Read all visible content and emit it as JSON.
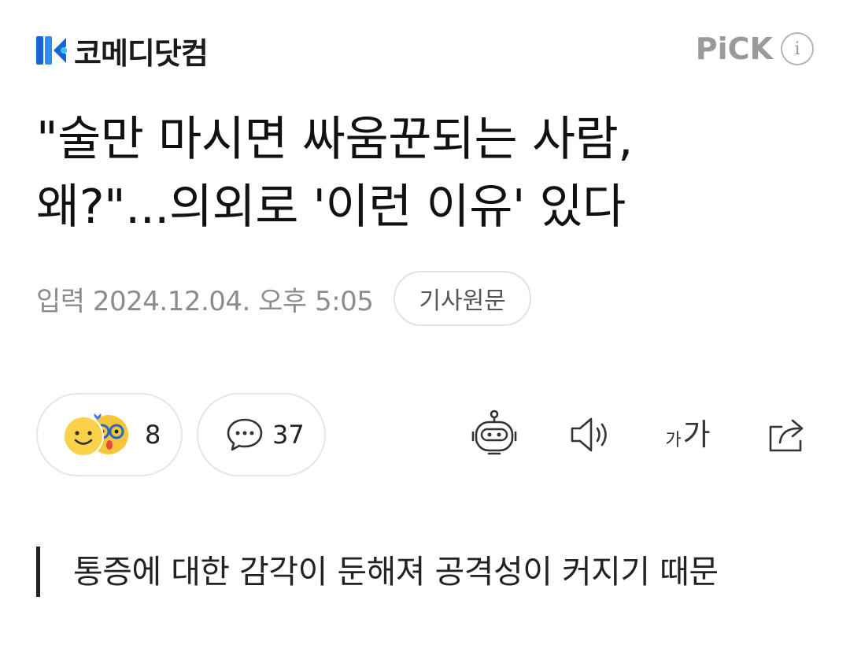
{
  "header": {
    "logo_text": "코메디닷컴",
    "pick_label": "PiCK",
    "info_label": "i",
    "logo_color": "#1565d8"
  },
  "article": {
    "title_line1": "\"술만 마시면 싸움꾼되는 사람,",
    "title_line2": "왜?\"...의외로 '이런 이유' 있다",
    "date": "입력 2024.12.04. 오후 5:05",
    "source_button": "기사원문"
  },
  "actions": {
    "reaction_count": "8",
    "comment_count": "37",
    "tools": [
      "robot-summary-icon",
      "speaker-icon",
      "font-size-icon",
      "share-icon"
    ],
    "font_small": "가",
    "font_big": "가"
  },
  "quote": {
    "text": "통증에 대한 감각이 둔해져 공격성이 커지기 때문"
  }
}
